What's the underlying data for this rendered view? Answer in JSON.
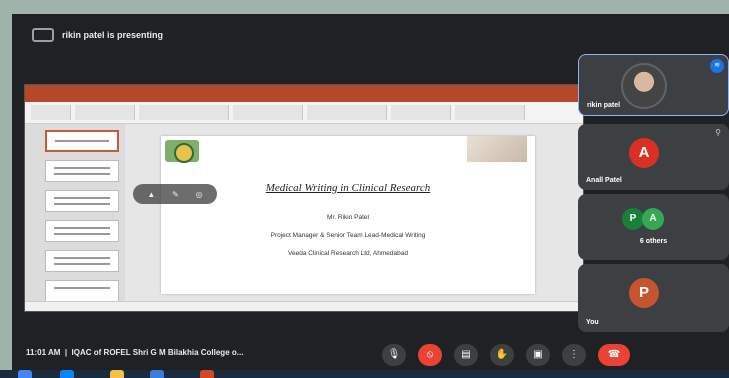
{
  "presenter": {
    "label": "rikin patel is presenting",
    "icon": "present-screen-icon"
  },
  "powerpoint": {
    "slide": {
      "title": "Medical Writing in Clinical Research",
      "lines": [
        "Mr. Rikin Patel",
        "Project Manager & Senior Team Lead-Medical Writing",
        "Veeda Clinical Research Ltd, Ahmedabad"
      ]
    },
    "slide_toolbar_icons": [
      "pointer-icon",
      "pen-icon",
      "more-icon"
    ]
  },
  "participants": [
    {
      "name": "rikin patel",
      "type": "photo",
      "speaking": true
    },
    {
      "name": "Anall Patel",
      "initial": "A",
      "color": "#d93025"
    },
    {
      "name": "6 others",
      "initials": [
        "P",
        "A"
      ]
    },
    {
      "name": "You",
      "initial": "P",
      "color": "#c5552f"
    }
  ],
  "bottom_bar": {
    "time": "11:01 AM",
    "separator": "|",
    "meeting_title": "IQAC of ROFEL Shri G M Bilakhia College o...",
    "controls": [
      {
        "name": "mic-button",
        "icon": "microphone-icon",
        "glyph": "🎙"
      },
      {
        "name": "camera-button",
        "icon": "camera-off-icon",
        "glyph": "⦸"
      },
      {
        "name": "captions-button",
        "icon": "captions-icon",
        "glyph": "▤"
      },
      {
        "name": "raise-hand-button",
        "icon": "hand-icon",
        "glyph": "✋"
      },
      {
        "name": "present-button",
        "icon": "present-icon",
        "glyph": "▣"
      },
      {
        "name": "more-options-button",
        "icon": "more-vert-icon",
        "glyph": "⋮"
      },
      {
        "name": "end-call-button",
        "icon": "end-call-icon",
        "glyph": "☎"
      }
    ]
  },
  "colors": {
    "accent": "#1a73e8",
    "danger": "#ea4335",
    "ppt": "#b7472a"
  }
}
